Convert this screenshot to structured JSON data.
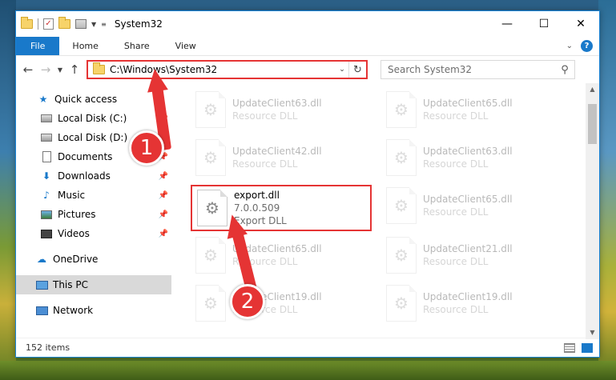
{
  "window": {
    "title": "System32",
    "minimize": "—",
    "maximize": "☐",
    "close": "✕"
  },
  "ribbon": {
    "tabs": [
      "File",
      "Home",
      "Share",
      "View"
    ]
  },
  "address": {
    "path": "C:\\Windows\\System32",
    "search_placeholder": "Search System32"
  },
  "nav": {
    "items": [
      {
        "label": "Quick access",
        "icon": "star-icon"
      },
      {
        "label": "Local Disk (C:)",
        "icon": "drive-icon",
        "pinned": true
      },
      {
        "label": "Local Disk (D:)",
        "icon": "drive-icon",
        "pinned": true
      },
      {
        "label": "Documents",
        "icon": "documents-icon",
        "pinned": true
      },
      {
        "label": "Downloads",
        "icon": "downloads-icon",
        "pinned": true
      },
      {
        "label": "Music",
        "icon": "music-icon",
        "pinned": true
      },
      {
        "label": "Pictures",
        "icon": "pictures-icon",
        "pinned": true
      },
      {
        "label": "Videos",
        "icon": "videos-icon",
        "pinned": true
      },
      {
        "label": "OneDrive",
        "icon": "onedrive-icon"
      },
      {
        "label": "This PC",
        "icon": "this-pc-icon",
        "selected": true
      },
      {
        "label": "Network",
        "icon": "network-icon"
      }
    ]
  },
  "files": [
    {
      "name": "UpdateClient63.dll",
      "sub": "Resource DLL",
      "faded": true
    },
    {
      "name": "UpdateClient65.dll",
      "sub": "Resource DLL",
      "faded": true
    },
    {
      "name": "UpdateClient42.dll",
      "sub": "Resource DLL",
      "faded": true
    },
    {
      "name": "UpdateClient63.dll",
      "sub": "Resource DLL",
      "faded": true
    },
    {
      "name": "export.dll",
      "version": "7.0.0.509",
      "sub": "Export DLL",
      "faded": false,
      "highlighted": true
    },
    {
      "name": "UpdateClient65.dll",
      "sub": "Resource DLL",
      "faded": true
    },
    {
      "name": "UpdateClient65.dll",
      "sub": "Resource DLL",
      "faded": true
    },
    {
      "name": "UpdateClient21.dll",
      "sub": "Resource DLL",
      "faded": true
    },
    {
      "name": "UpdateClient19.dll",
      "sub": "Resource DLL",
      "faded": true
    },
    {
      "name": "UpdateClient19.dll",
      "sub": "Resource DLL",
      "faded": true
    }
  ],
  "status": {
    "count": "152 items"
  },
  "callouts": [
    "1",
    "2"
  ],
  "colors": {
    "accent": "#1979ca",
    "highlight": "#e53434",
    "selected_nav": "#d9d9d9"
  }
}
